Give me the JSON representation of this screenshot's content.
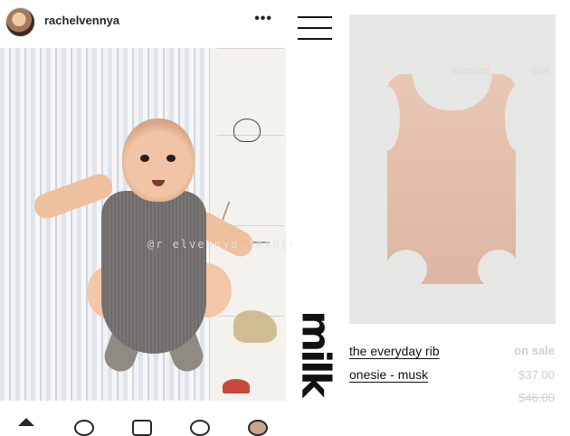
{
  "instagram": {
    "username": "rachelvennya",
    "more": "•••",
    "watermark": "@r   elvennya.fashion"
  },
  "shop": {
    "logo": "milk",
    "nav": {
      "account": "account",
      "cart": "cart"
    },
    "product": {
      "title_line1": "the everyday rib",
      "title_line2": "onesie - musk",
      "sale_label": "on sale",
      "price": "$37.00",
      "old_price": "$46.00"
    }
  },
  "colors": {
    "onesie_grey": "#7b7676",
    "product_pink": "#e9c7b4",
    "muted_text": "#cfcfcf"
  }
}
